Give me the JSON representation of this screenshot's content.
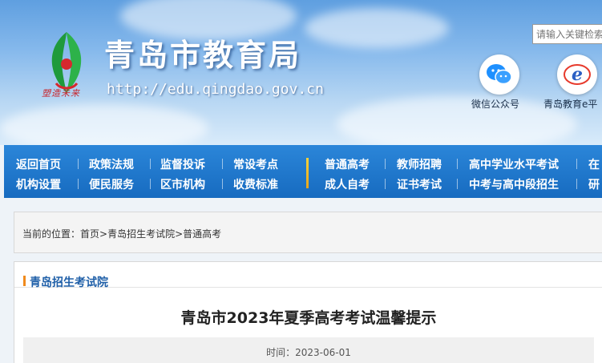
{
  "header": {
    "site_title": "青岛市教育局",
    "site_url": "http://edu.qingdao.gov.cn",
    "logo_slogan": "塑造未来",
    "search_placeholder": "请输入关键检索",
    "qr_wechat_label": "微信公众号",
    "qr_eplatform_label": "青岛教育e平",
    "colors": {
      "logo_green": "#1f9a3c",
      "logo_red": "#d7282e",
      "wechat_blue": "#1e90ff",
      "e_blue": "#2a5fc4"
    }
  },
  "nav": {
    "row1": [
      "返回首页",
      "政策法规",
      "监督投诉",
      "常设考点",
      "普通高考",
      "教师招聘",
      "高中学业水平考试",
      "在"
    ],
    "row2": [
      "机构设置",
      "便民服务",
      "区市机构",
      "收费标准",
      "成人自考",
      "证书考试",
      "中考与高中段招生",
      "研"
    ],
    "colors": {
      "bg": "#1f78cd",
      "divider": "#f0c030"
    }
  },
  "breadcrumb": {
    "prefix": "当前的位置：",
    "items": [
      "首页",
      "青岛招生考试院",
      "普通高考"
    ],
    "separator": ">"
  },
  "section": {
    "title": "青岛招生考试院"
  },
  "article": {
    "title": "青岛市2023年夏季高考考试温馨提示",
    "time_label": "时间：",
    "time_value": "2023-06-01"
  }
}
